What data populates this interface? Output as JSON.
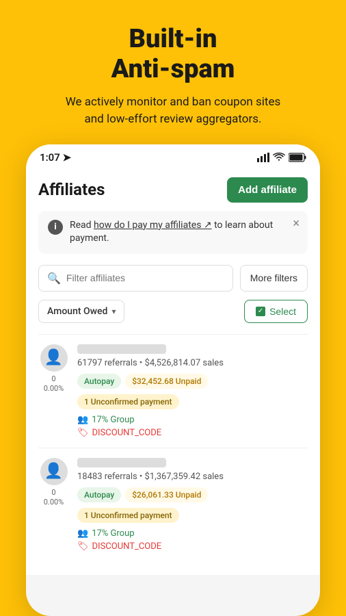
{
  "hero": {
    "title": "Built-in\nAnti-spam",
    "subtitle": "We actively monitor and ban coupon sites\nand low-effort review aggregators."
  },
  "status_bar": {
    "time": "1:07",
    "time_icon": "→"
  },
  "header": {
    "title": "Affiliates",
    "add_button": "Add affiliate"
  },
  "info_banner": {
    "text_before": "Read ",
    "link": "how do I pay my affiliates",
    "text_after": " to learn about payment."
  },
  "search": {
    "placeholder": "Filter affiliates"
  },
  "filters": {
    "more_filters": "More filters",
    "amount_owed": "Amount Owed",
    "select": "Select"
  },
  "affiliates": [
    {
      "count": "0",
      "percent": "0.00%",
      "referrals": "61797 referrals • $4,526,814.07 sales",
      "autopay": "Autopay",
      "unpaid": "$32,452.68 Unpaid",
      "unconfirmed": "1 Unconfirmed payment",
      "group": "17% Group",
      "code": "DISCOUNT_CODE"
    },
    {
      "count": "0",
      "percent": "0.00%",
      "referrals": "18483 referrals • $1,367,359.42 sales",
      "autopay": "Autopay",
      "unpaid": "$26,061.33 Unpaid",
      "unconfirmed": "1 Unconfirmed payment",
      "group": "17% Group",
      "code": "DISCOUNT_CODE"
    }
  ]
}
